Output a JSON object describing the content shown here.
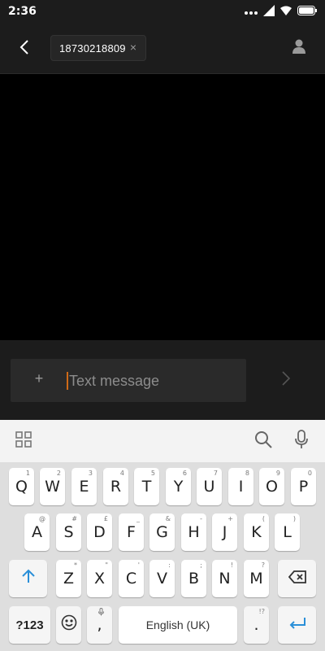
{
  "status_bar": {
    "time": "2:36"
  },
  "header": {
    "recipient_number": "18730218809",
    "chip_close": "×"
  },
  "compose": {
    "placeholder": "Text message",
    "attach": "+"
  },
  "keyboard": {
    "row1": [
      {
        "key": "Q",
        "hint": "1"
      },
      {
        "key": "W",
        "hint": "2"
      },
      {
        "key": "E",
        "hint": "3"
      },
      {
        "key": "R",
        "hint": "4"
      },
      {
        "key": "T",
        "hint": "5"
      },
      {
        "key": "Y",
        "hint": "6"
      },
      {
        "key": "U",
        "hint": "7"
      },
      {
        "key": "I",
        "hint": "8"
      },
      {
        "key": "O",
        "hint": "9"
      },
      {
        "key": "P",
        "hint": "0"
      }
    ],
    "row2": [
      {
        "key": "A",
        "hint": "@"
      },
      {
        "key": "S",
        "hint": "#"
      },
      {
        "key": "D",
        "hint": "£"
      },
      {
        "key": "F",
        "hint": "_"
      },
      {
        "key": "G",
        "hint": "&"
      },
      {
        "key": "H",
        "hint": "-"
      },
      {
        "key": "J",
        "hint": "+"
      },
      {
        "key": "K",
        "hint": "("
      },
      {
        "key": "L",
        "hint": ")"
      }
    ],
    "row3": [
      {
        "key": "Z",
        "hint": "*"
      },
      {
        "key": "X",
        "hint": "\""
      },
      {
        "key": "C",
        "hint": "'"
      },
      {
        "key": "V",
        "hint": ":"
      },
      {
        "key": "B",
        "hint": ";"
      },
      {
        "key": "N",
        "hint": "!"
      },
      {
        "key": "M",
        "hint": "?"
      }
    ],
    "symbols_label": "?123",
    "comma": ",",
    "space_label": "English (UK)",
    "period": ".",
    "period_hint": "!?"
  },
  "colors": {
    "accent_blue": "#2a8fd8",
    "caret_orange": "#d06a17",
    "header_bg": "#1c1c1c",
    "keyboard_bg": "#dedede"
  },
  "icons": {
    "back": "chevron-left-icon",
    "contact": "person-icon",
    "send": "chevron-right-icon",
    "grid": "grid-icon",
    "search": "search-icon",
    "mic": "mic-icon",
    "shift": "shift-arrow-icon",
    "backspace": "backspace-icon",
    "emoji": "emoji-icon",
    "enter": "enter-icon"
  }
}
